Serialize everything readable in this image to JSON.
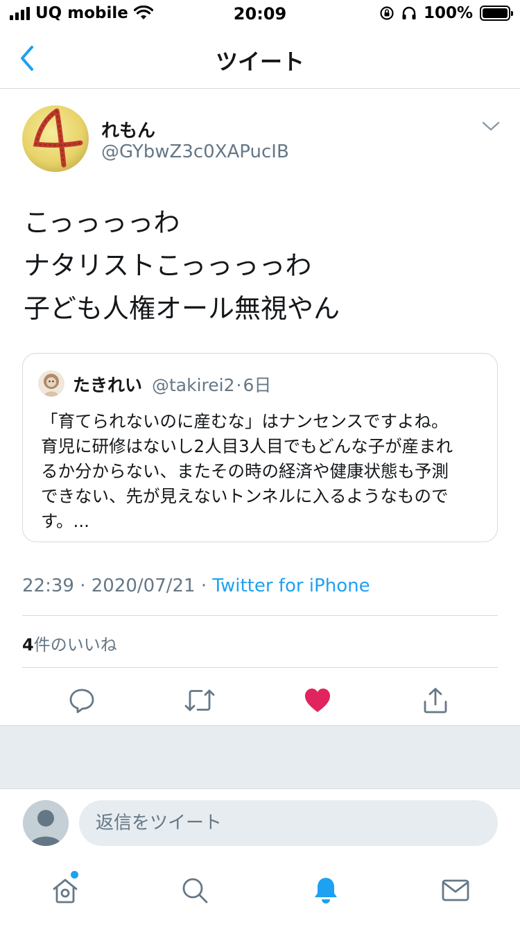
{
  "status_bar": {
    "carrier": "UQ mobile",
    "time": "20:09",
    "battery": "100%"
  },
  "nav": {
    "title": "ツイート"
  },
  "tweet": {
    "user_name": "れもん",
    "user_handle": "@GYbwZ3c0XAPucIB",
    "lines": [
      "こっっっっわ",
      "ナタリストこっっっっわ",
      "子ども人権オール無視やん"
    ],
    "time": "22:39",
    "date": "2020/07/21",
    "source": "Twitter for iPhone",
    "likes_count": "4",
    "likes_label": "件のいいね"
  },
  "quote": {
    "user_name": "たきれい",
    "user_handle": "@takirei2",
    "age": "6日",
    "lines": [
      "「育てられないのに産むな」はナンセンスですよね。",
      "育児に研修はないし2人目3人目でもどんな子が産まれ",
      "るか分からない、またその時の経済や健康状態も予測",
      "できない、先が見えないトンネルに入るようなもので",
      "す。..."
    ]
  },
  "reply": {
    "placeholder": "返信をツイート"
  },
  "colors": {
    "accent": "#1da1f2",
    "like": "#e0245e",
    "secondary_text": "#657786",
    "divider": "#d6d9dc",
    "band": "#e6ecf0"
  },
  "icons": {
    "actions": [
      "reply-icon",
      "retweet-icon",
      "like-icon-filled",
      "share-icon"
    ],
    "tabs": [
      "home-icon",
      "search-icon",
      "notifications-icon",
      "messages-icon"
    ]
  }
}
